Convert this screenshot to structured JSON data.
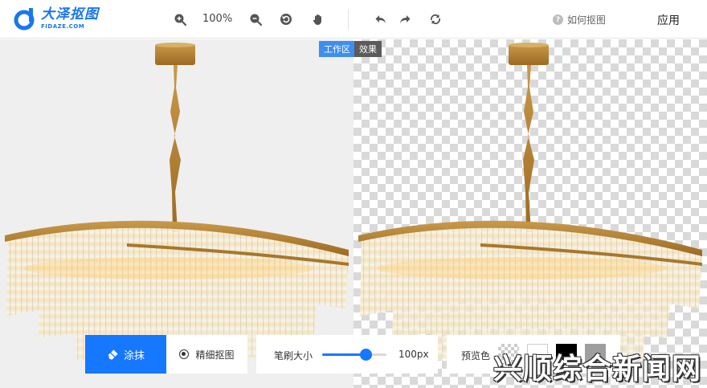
{
  "app": {
    "logo_name": "大泽抠图",
    "logo_domain": "FIDAZE.COM"
  },
  "toolbar": {
    "zoom_in_icon": "zoom-in-icon",
    "zoom_level": "100%",
    "zoom_out_icon": "zoom-out-icon",
    "reset_icon": "rotate-reset-icon",
    "pan_icon": "hand-icon",
    "undo_icon": "undo-icon",
    "redo_icon": "redo-icon",
    "refresh_icon": "refresh-icon",
    "help_label": "如何抠图",
    "apply_label": "应用"
  },
  "view_tabs": {
    "work": "工作区",
    "effect": "效果"
  },
  "tools": {
    "smear_label": "涂抹",
    "fine_label": "精细抠图",
    "brush_size_label": "笔刷大小",
    "brush_size_value": "100px",
    "brush_size_fraction": 0.67,
    "preview_color_label": "预览色"
  },
  "preview_swatches": [
    "transparent",
    "#ffffff",
    "#000000",
    "#9e9e9e"
  ],
  "watermark": "兴顺综合新闻网",
  "colors": {
    "accent": "#1677ff",
    "tab_work": "#3d8ef0",
    "tab_effect": "#5b5b5b"
  }
}
